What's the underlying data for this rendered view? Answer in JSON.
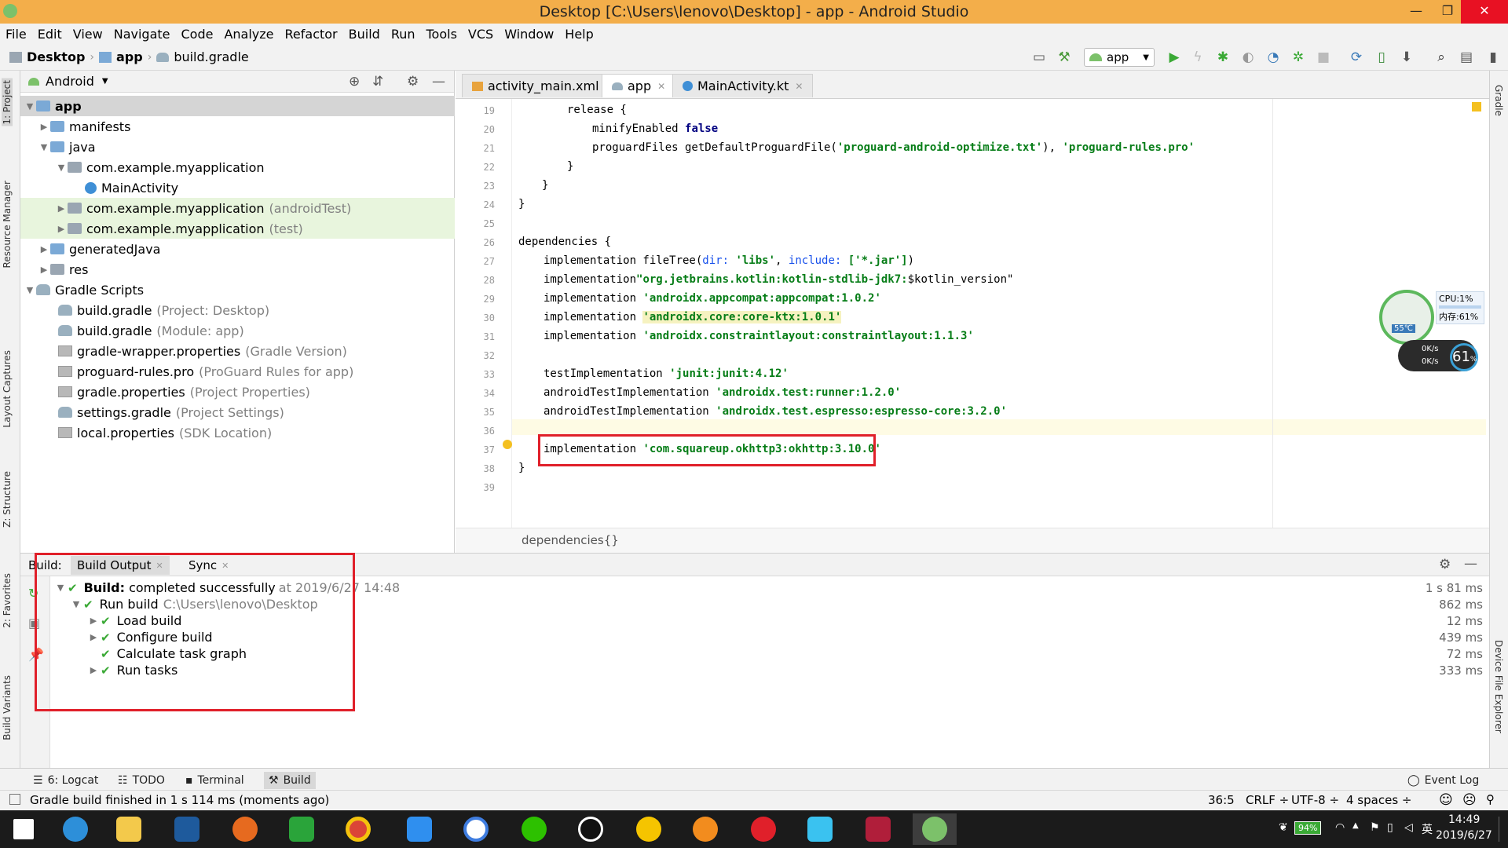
{
  "window": {
    "title": "Desktop [C:\\Users\\lenovo\\Desktop] - app - Android Studio",
    "minimize": "—",
    "maximize": "❐",
    "close": "✕"
  },
  "menu": [
    "File",
    "Edit",
    "View",
    "Navigate",
    "Code",
    "Analyze",
    "Refactor",
    "Build",
    "Run",
    "Tools",
    "VCS",
    "Window",
    "Help"
  ],
  "breadcrumb": {
    "root": "Desktop",
    "module": "app",
    "file": "build.gradle"
  },
  "run_config": "app",
  "project_panel": {
    "view": "Android",
    "tree": [
      {
        "label": "app",
        "hint": "",
        "bold": true
      },
      {
        "label": "manifests",
        "hint": ""
      },
      {
        "label": "java",
        "hint": ""
      },
      {
        "label": "com.example.myapplication",
        "hint": ""
      },
      {
        "label": "MainActivity",
        "hint": ""
      },
      {
        "label": "com.example.myapplication",
        "hint": "(androidTest)"
      },
      {
        "label": "com.example.myapplication",
        "hint": "(test)"
      },
      {
        "label": "generatedJava",
        "hint": ""
      },
      {
        "label": "res",
        "hint": ""
      },
      {
        "label": "Gradle Scripts",
        "hint": ""
      },
      {
        "label": "build.gradle",
        "hint": "(Project: Desktop)"
      },
      {
        "label": "build.gradle",
        "hint": "(Module: app)"
      },
      {
        "label": "gradle-wrapper.properties",
        "hint": "(Gradle Version)"
      },
      {
        "label": "proguard-rules.pro",
        "hint": "(ProGuard Rules for app)"
      },
      {
        "label": "gradle.properties",
        "hint": "(Project Properties)"
      },
      {
        "label": "settings.gradle",
        "hint": "(Project Settings)"
      },
      {
        "label": "local.properties",
        "hint": "(SDK Location)"
      }
    ]
  },
  "editor_tabs": [
    "activity_main.xml",
    "app",
    "MainActivity.kt"
  ],
  "code": {
    "line_numbers": [
      "19",
      "20",
      "21",
      "22",
      "23",
      "24",
      "25",
      "26",
      "27",
      "28",
      "29",
      "30",
      "31",
      "32",
      "33",
      "34",
      "35",
      "36",
      "37",
      "38",
      "39"
    ],
    "l19": "release {",
    "l20a": "minifyEnabled ",
    "l20b": "false",
    "l21a": "proguardFiles getDefaultProguardFile(",
    "l21b": "'proguard-android-optimize.txt'",
    "l21c": "), ",
    "l21d": "'proguard-rules.pro'",
    "l22": "}",
    "l23": "}",
    "l24": "}",
    "l26": "dependencies {",
    "l27a": "implementation fileTree(",
    "l27b": "dir: ",
    "l27c": "'libs'",
    "l27d": ", ",
    "l27e": "include: ",
    "l27f": "['*.jar']",
    "l27g": ")",
    "l28a": "implementation",
    "l28b": "\"org.jetbrains.kotlin:kotlin-stdlib-jdk7:",
    "l28c": "$kotlin_version\"",
    "l29a": "implementation ",
    "l29b": "'androidx.appcompat:appcompat:1.0.2'",
    "l30a": "implementation ",
    "l30b": "'androidx.core:core-ktx:1.0.1'",
    "l31a": "implementation ",
    "l31b": "'androidx.constraintlayout:constraintlayout:1.1.3'",
    "l33a": "testImplementation ",
    "l33b": "'junit:junit:4.12'",
    "l34a": "androidTestImplementation ",
    "l34b": "'androidx.test:runner:1.2.0'",
    "l35a": "androidTestImplementation ",
    "l35b": "'androidx.test.espresso:espresso-core:3.2.0'",
    "l37a": "implementation ",
    "l37b": "'com.squareup.okhttp3:okhttp:3.10.0'",
    "l38": "}"
  },
  "editor_breadcrumb": "dependencies{}",
  "build_panel": {
    "label": "Build:",
    "tabs": [
      "Build Output",
      "Sync"
    ],
    "rows": [
      {
        "title": "Build:",
        "text": "completed successfully",
        "hint": "at 2019/6/27 14:48",
        "time": "1 s 81 ms"
      },
      {
        "title": "",
        "text": "Run build",
        "hint": "C:\\Users\\lenovo\\Desktop",
        "time": "862 ms"
      },
      {
        "title": "",
        "text": "Load build",
        "hint": "",
        "time": "12 ms"
      },
      {
        "title": "",
        "text": "Configure build",
        "hint": "",
        "time": "439 ms"
      },
      {
        "title": "",
        "text": "Calculate task graph",
        "hint": "",
        "time": "72 ms"
      },
      {
        "title": "",
        "text": "Run tasks",
        "hint": "",
        "time": "333 ms"
      }
    ]
  },
  "bottom_tabs": [
    "6: Logcat",
    "TODO",
    "Terminal",
    "Build"
  ],
  "event_log": "Event Log",
  "status": {
    "message": "Gradle build finished in 1 s 114 ms (moments ago)",
    "position": "36:5",
    "line_sep": "CRLF ÷",
    "encoding": "UTF-8 ÷",
    "indent": "4 spaces ÷"
  },
  "left_tools": [
    "1: Project",
    "Resource Manager",
    "Layout Captures",
    "Z: Structure",
    "2: Favorites",
    "Build Variants"
  ],
  "right_tools": [
    "Gradle",
    "Device File Explorer"
  ],
  "perf_widget": {
    "cpu": "CPU:1%",
    "mem": "内存:61%",
    "temp": "55℃",
    "up": "0K/s",
    "down": "0K/s",
    "pct": "61",
    "pct_unit": "%"
  },
  "taskbar": {
    "battery": "94%",
    "time": "14:49",
    "date": "2019/6/27",
    "ime": "英"
  },
  "colors": {
    "titlebar": "#f3ae4a",
    "highlight_box": "#e0202a",
    "success": "#3aa935",
    "string": "#067d17"
  }
}
